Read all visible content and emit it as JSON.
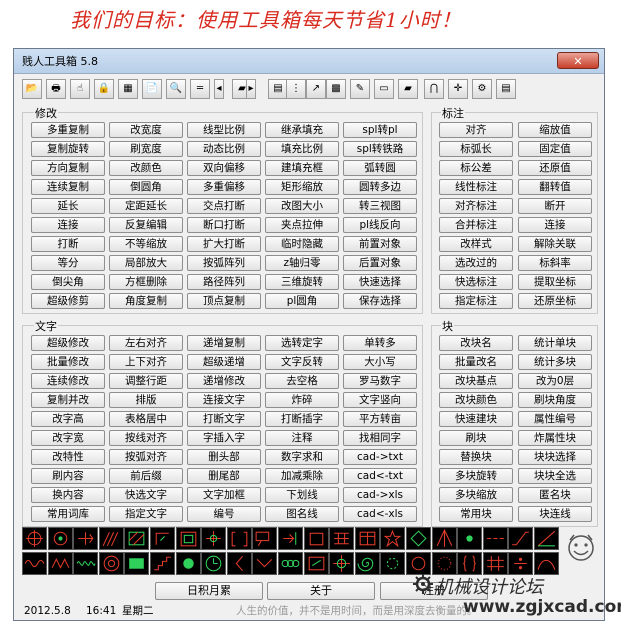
{
  "slogan": "我们的目标：使用工具箱每天节省1小时！",
  "window": {
    "title": "贱人工具箱 5.8",
    "close_symbol": "✕"
  },
  "toolbar": {
    "icons": [
      "open-folder-icon",
      "print-icon",
      "hand-pointer-icon",
      "lock-icon",
      "calculator-icon",
      "notepad-icon",
      "magnifier-icon",
      "measure-icon",
      "arrow-left-icon",
      "book-icon",
      "arrow-right-icon",
      "layers-icon",
      "scissor-icon",
      "export-icon",
      "palette-icon",
      "pencil-icon",
      "keyboard-icon",
      "eraser-icon",
      "magnet-icon",
      "crosshair-icon",
      "gear-icon",
      "printer-small-icon"
    ]
  },
  "groups": {
    "modify": {
      "label": "修改",
      "rows": [
        [
          "多重复制",
          "改宽度",
          "线型比例",
          "继承填充",
          "spl转pl"
        ],
        [
          "复制旋转",
          "刷宽度",
          "动态比例",
          "填充比例",
          "spl转铁路"
        ],
        [
          "方向复制",
          "改颜色",
          "双向偏移",
          "建填充框",
          "弧转圆"
        ],
        [
          "连续复制",
          "倒圆角",
          "多重偏移",
          "矩形缩放",
          "圆转多边"
        ],
        [
          "延长",
          "定距延长",
          "交点打断",
          "改图大小",
          "转三视图"
        ],
        [
          "连接",
          "反复编辑",
          "断口打断",
          "夹点拉伸",
          "pl线反向"
        ],
        [
          "打断",
          "不等缩放",
          "扩大打断",
          "临时隐藏",
          "前置对象"
        ],
        [
          "等分",
          "局部放大",
          "按弧阵列",
          "z轴归零",
          "后置对象"
        ],
        [
          "倒尖角",
          "方框删除",
          "路径阵列",
          "三维旋转",
          "快速选择"
        ],
        [
          "超级修剪",
          "角度复制",
          "顶点复制",
          "pl圆角",
          "保存选择"
        ]
      ]
    },
    "dimension": {
      "label": "标注",
      "rows": [
        [
          "对齐",
          "缩放值"
        ],
        [
          "标弧长",
          "固定值"
        ],
        [
          "标公差",
          "还原值"
        ],
        [
          "线性标注",
          "翻转值"
        ],
        [
          "对齐标注",
          "断开"
        ],
        [
          "合并标注",
          "连接"
        ],
        [
          "改样式",
          "解除关联"
        ],
        [
          "选改过的",
          "标斜率"
        ],
        [
          "快选标注",
          "提取坐标"
        ],
        [
          "指定标注",
          "还原坐标"
        ]
      ]
    },
    "text": {
      "label": "文字",
      "rows": [
        [
          "超级修改",
          "左右对齐",
          "递增复制",
          "选转定字",
          "单转多"
        ],
        [
          "批量修改",
          "上下对齐",
          "超级递增",
          "文字反转",
          "大小写"
        ],
        [
          "连续修改",
          "调整行距",
          "递增修改",
          "去空格",
          "罗马数字"
        ],
        [
          "复制并改",
          "排版",
          "连接文字",
          "炸碎",
          "文字竖向"
        ],
        [
          "改字高",
          "表格居中",
          "打断文字",
          "打断插字",
          "平方转亩"
        ],
        [
          "改字宽",
          "按线对齐",
          "字插入字",
          "注释",
          "找相同字"
        ],
        [
          "改特性",
          "按弧对齐",
          "删头部",
          "数字求和",
          "cad->txt"
        ],
        [
          "刷内容",
          "前后缀",
          "删尾部",
          "加减乘除",
          "cad<-txt"
        ],
        [
          "换内容",
          "快选文字",
          "文字加框",
          "下划线",
          "cad->xls"
        ],
        [
          "常用词库",
          "指定文字",
          "编号",
          "图名线",
          "cad<-xls"
        ]
      ]
    },
    "block": {
      "label": "块",
      "rows": [
        [
          "改块名",
          "统计单块"
        ],
        [
          "批量改名",
          "统计多块"
        ],
        [
          "改块基点",
          "改为0层"
        ],
        [
          "改块颜色",
          "刷块角度"
        ],
        [
          "快速建块",
          "属性编号"
        ],
        [
          "刷块",
          "炸属性块"
        ],
        [
          "替换块",
          "块块选择"
        ],
        [
          "多块旋转",
          "块块全选"
        ],
        [
          "多块缩放",
          "匿名块"
        ],
        [
          "常用块",
          "块连线"
        ]
      ]
    }
  },
  "icon_strip": {
    "row1": [
      "target-icon",
      "circle-cross-icon",
      "arrow-split-icon",
      "hatch-icon",
      "hatch-dense-icon",
      "corner-icon",
      "frame-icon",
      "center-mark-icon",
      "bracket-icon",
      "callout-icon",
      "arrow-flag-icon",
      "square-icon",
      "grid-icon",
      "table-icon",
      "star-icon",
      "diamond-icon",
      "spike-icon",
      "circle-dot-icon",
      "line-dash-icon",
      "dash-rise-icon",
      "ramp-icon"
    ],
    "row2": [
      "wave-icon",
      "zigzag-icon",
      "spring-icon",
      "concentric-icon",
      "rect-green-icon",
      "step-icon",
      "bullet-icon",
      "clock-icon",
      "bracket-left-icon",
      "chevron-icon",
      "flower-icon",
      "box-arrow-icon",
      "cross-hair-icon",
      "spiral-icon",
      "gear-small-icon",
      "ring-icon",
      "ring-dots-icon",
      "brace-icon",
      "hash-icon",
      "fraction-icon",
      "curve-icon"
    ],
    "logo": "smiley-logo-icon"
  },
  "bottom_buttons": [
    "日积月累",
    "关于",
    "注册"
  ],
  "status": {
    "date": "2012.5.8",
    "time": "16:41",
    "weekday": "星期二",
    "motto": "人生的价值，并不是用时间，而是用深度去衡量的。"
  },
  "watermark": {
    "name": "机械设计论坛",
    "url": "www.zgjxcad.com"
  },
  "colors": {
    "slogan": "#d82a1e",
    "icon_stroke": "#e23b2b",
    "icon_accent": "#2fd15b",
    "window_bg": "#f0f0f0"
  }
}
